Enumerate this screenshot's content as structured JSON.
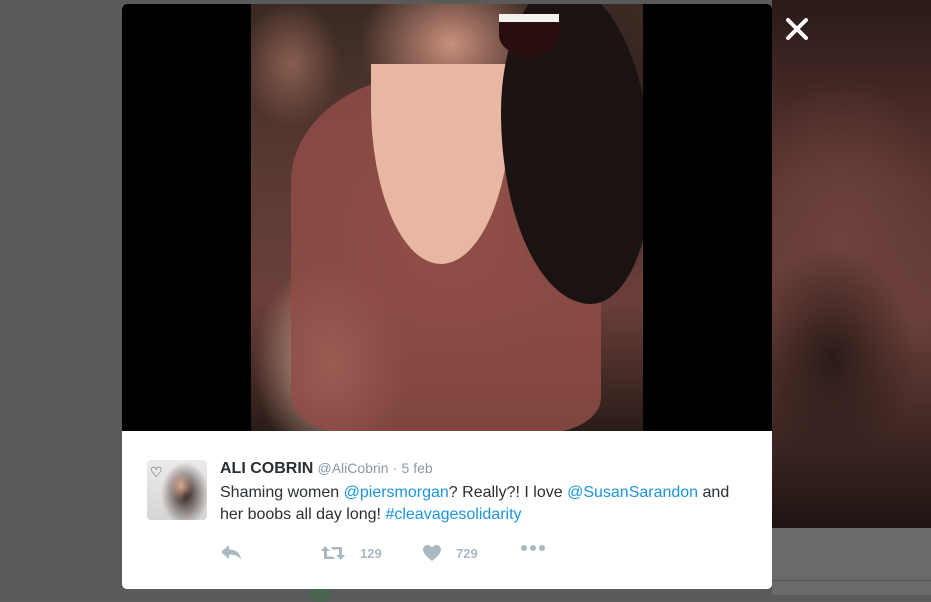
{
  "close_label": "×",
  "tweet": {
    "display_name": "ALI COBRIN",
    "handle": "@AliCobrin",
    "separator": "·",
    "date": "5 feb",
    "text_parts": [
      {
        "text": "Shaming women ",
        "link": false
      },
      {
        "text": "@piersmorgan",
        "link": true
      },
      {
        "text": "? Really?! I love ",
        "link": false
      },
      {
        "text": "@SusanSarandon",
        "link": true
      },
      {
        "text": " and her boobs all day long! ",
        "link": false
      },
      {
        "text": "#cleavagesolidarity",
        "link": true
      }
    ],
    "retweet_count": "129",
    "like_count": "729"
  },
  "icons": {
    "reply": "reply-icon",
    "retweet": "retweet-icon",
    "like": "heart-icon",
    "more": "more-icon",
    "close": "close-icon",
    "avatar_heart": "heart-doodle-icon"
  },
  "colors": {
    "link": "#1b95e0",
    "text": "#292f33",
    "muted": "#8899a6",
    "action": "#aab8c2",
    "backdrop": "#5a5a5a"
  }
}
